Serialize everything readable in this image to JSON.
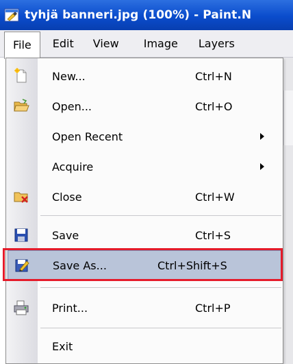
{
  "window": {
    "title": "tyhjä banneri.jpg (100%) - Paint.N",
    "icon": "paint-app-icon"
  },
  "menubar": {
    "items": [
      "File",
      "Edit",
      "View",
      "Image",
      "Layers"
    ]
  },
  "file_menu": {
    "items": [
      {
        "label": "New...",
        "shortcut": "Ctrl+N",
        "icon": "new-document-icon"
      },
      {
        "label": "Open...",
        "shortcut": "Ctrl+O",
        "icon": "open-folder-icon"
      },
      {
        "label": "Open Recent",
        "shortcut": "",
        "icon": ""
      },
      {
        "label": "Acquire",
        "shortcut": "",
        "icon": ""
      },
      {
        "label": "Close",
        "shortcut": "Ctrl+W",
        "icon": "close-folder-icon"
      },
      {
        "label": "Save",
        "shortcut": "Ctrl+S",
        "icon": "floppy-disk-icon"
      },
      {
        "label": "Save As...",
        "shortcut": "Ctrl+Shift+S",
        "icon": "save-as-icon"
      },
      {
        "label": "Print...",
        "shortcut": "Ctrl+P",
        "icon": "printer-icon"
      },
      {
        "label": "Exit",
        "shortcut": "",
        "icon": ""
      }
    ],
    "selected": "Save As..."
  },
  "colors": {
    "titlebar": "#0a4ccc",
    "selection": "#b9c4d9",
    "highlight_box": "#e51b2a"
  }
}
